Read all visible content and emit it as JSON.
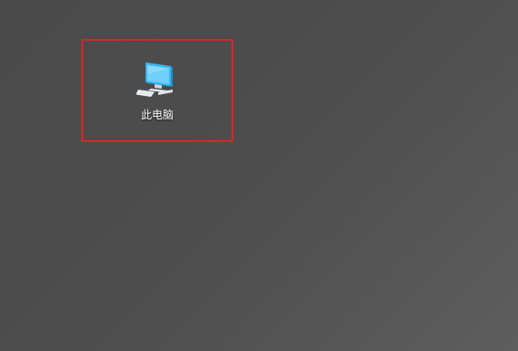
{
  "desktop": {
    "icons": [
      {
        "label": "此电脑",
        "icon": "this-pc-icon"
      }
    ],
    "highlight_color": "#e02424"
  }
}
